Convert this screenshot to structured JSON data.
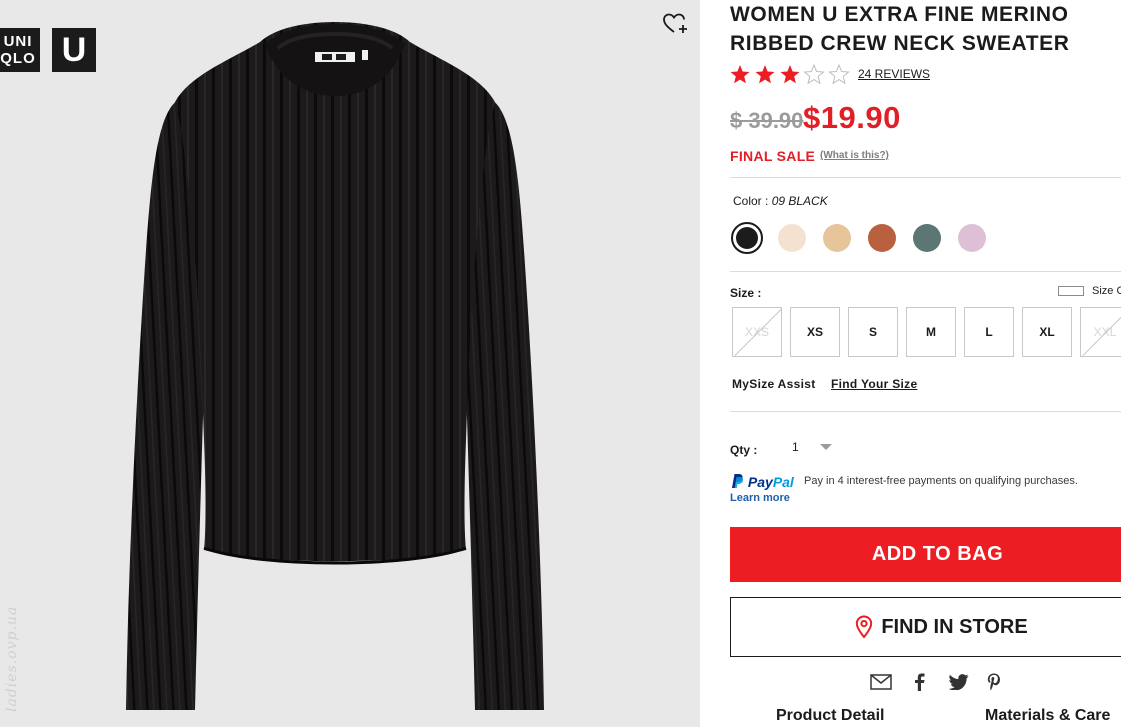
{
  "brand": {
    "logo_text": "UNI\nQLO",
    "logo_u": "U"
  },
  "watermark": "ladies.ovp.ua",
  "product": {
    "title": "WOMEN U EXTRA FINE MERINO RIBBED CREW NECK SWEATER",
    "rating": 3.5,
    "reviews_label": "24 REVIEWS",
    "old_price": "$ 39.90",
    "new_price": "$19.90",
    "sale_label": "FINAL SALE",
    "sale_help": "(What is this?)"
  },
  "color": {
    "label": "Color :",
    "selected": "09 BLACK",
    "swatches": [
      "#1c1c1c",
      "#f5e1d0",
      "#e6c59b",
      "#b9603f",
      "#5b7673",
      "#ddbfd6"
    ]
  },
  "size": {
    "label": "Size :",
    "chart_label": "Size C",
    "options": [
      {
        "label": "XXS",
        "available": false
      },
      {
        "label": "XS",
        "available": true
      },
      {
        "label": "S",
        "available": true
      },
      {
        "label": "M",
        "available": true
      },
      {
        "label": "L",
        "available": true
      },
      {
        "label": "XL",
        "available": true
      },
      {
        "label": "XXL",
        "available": false
      }
    ],
    "mysize_label": "MySize Assist",
    "find_size_label": "Find Your Size"
  },
  "qty": {
    "label": "Qty :",
    "value": "1"
  },
  "paypal": {
    "brand_pay": "Pay",
    "brand_pal": "Pal",
    "text": "Pay in 4 interest-free payments on qualifying purchases.",
    "learn_more": "Learn more"
  },
  "actions": {
    "add_to_bag": "ADD TO BAG",
    "find_in_store": "FIND IN STORE"
  },
  "share_icons": [
    "email-icon",
    "facebook-icon",
    "twitter-icon",
    "pinterest-icon"
  ],
  "tabs": {
    "product_detail": "Product Detail",
    "materials_care": "Materials & Care"
  },
  "colors": {
    "accent": "#ed1d24",
    "text": "#1b1b1b",
    "image_bg": "#e8e8e8"
  }
}
